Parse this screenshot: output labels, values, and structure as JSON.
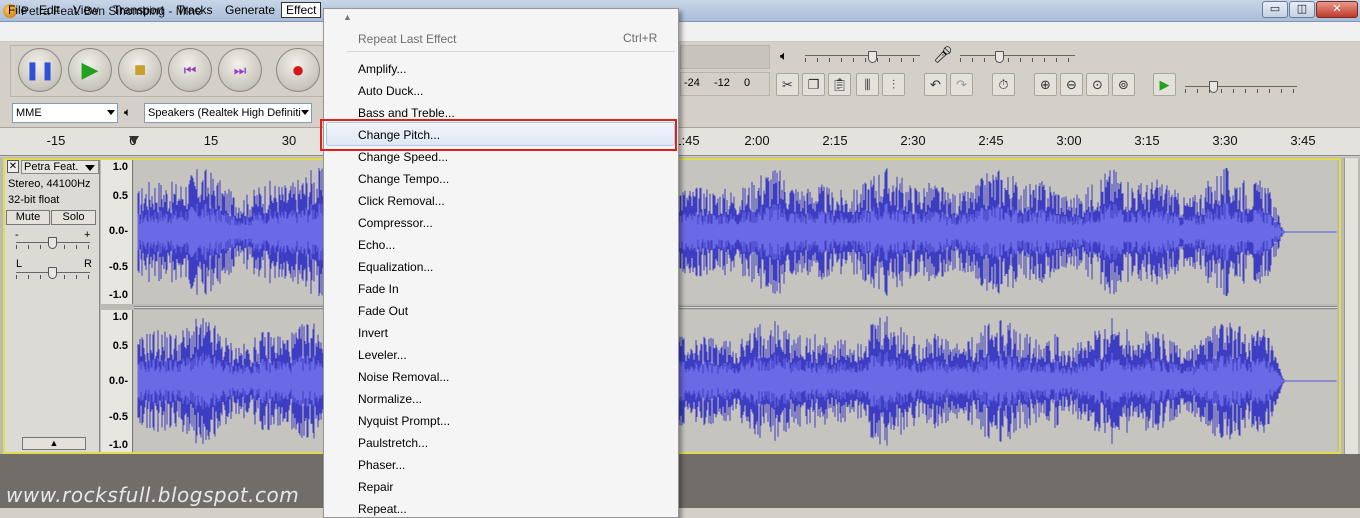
{
  "window": {
    "title": "Petra Feat. Ben Sihombing - Mine",
    "minimize_glyph": "▭",
    "maximize_glyph": "◫",
    "close_glyph": "✕"
  },
  "menubar": [
    "File",
    "Edit",
    "View",
    "Transport",
    "Tracks",
    "Generate",
    "Effect"
  ],
  "toolbar": {
    "host": "MME",
    "output_device": "Speakers (Realtek High Definiti",
    "meter_labels": [
      "-24",
      "-12",
      "0"
    ],
    "play_at_speed_glyph": "▶"
  },
  "ruler": [
    "-15",
    "0",
    "15",
    "30",
    "1:45",
    "2:00",
    "2:15",
    "2:30",
    "2:45",
    "3:00",
    "3:15",
    "3:30",
    "3:45"
  ],
  "track": {
    "name": "Petra Feat.",
    "close_glyph": "✕",
    "format": "Stereo, 44100Hz",
    "bit_depth": "32-bit float",
    "mute": "Mute",
    "solo": "Solo",
    "gain_minus": "-",
    "gain_plus": "+",
    "pan_left": "L",
    "pan_right": "R",
    "collapse_glyph": "▲",
    "scale": [
      "1.0",
      "0.5",
      "0.0-",
      "-0.5",
      "-1.0"
    ]
  },
  "effect_menu": {
    "repeat_last": "Repeat Last Effect",
    "repeat_shortcut": "Ctrl+R",
    "scroll_glyph": "▲",
    "items": [
      "Amplify...",
      "Auto Duck...",
      "Bass and Treble...",
      "Change Pitch...",
      "Change Speed...",
      "Change Tempo...",
      "Click Removal...",
      "Compressor...",
      "Echo...",
      "Equalization...",
      "Fade In",
      "Fade Out",
      "Invert",
      "Leveler...",
      "Noise Removal...",
      "Normalize...",
      "Nyquist Prompt...",
      "Paulstretch...",
      "Phaser...",
      "Repair",
      "Repeat..."
    ],
    "highlighted": "Change Pitch..."
  },
  "watermark": "www.rocksfull.blogspot.com",
  "colors": {
    "waveform": "#3d3dc4",
    "highlight_box": "#e0201b",
    "selection_frame": "#e2dc4a"
  }
}
